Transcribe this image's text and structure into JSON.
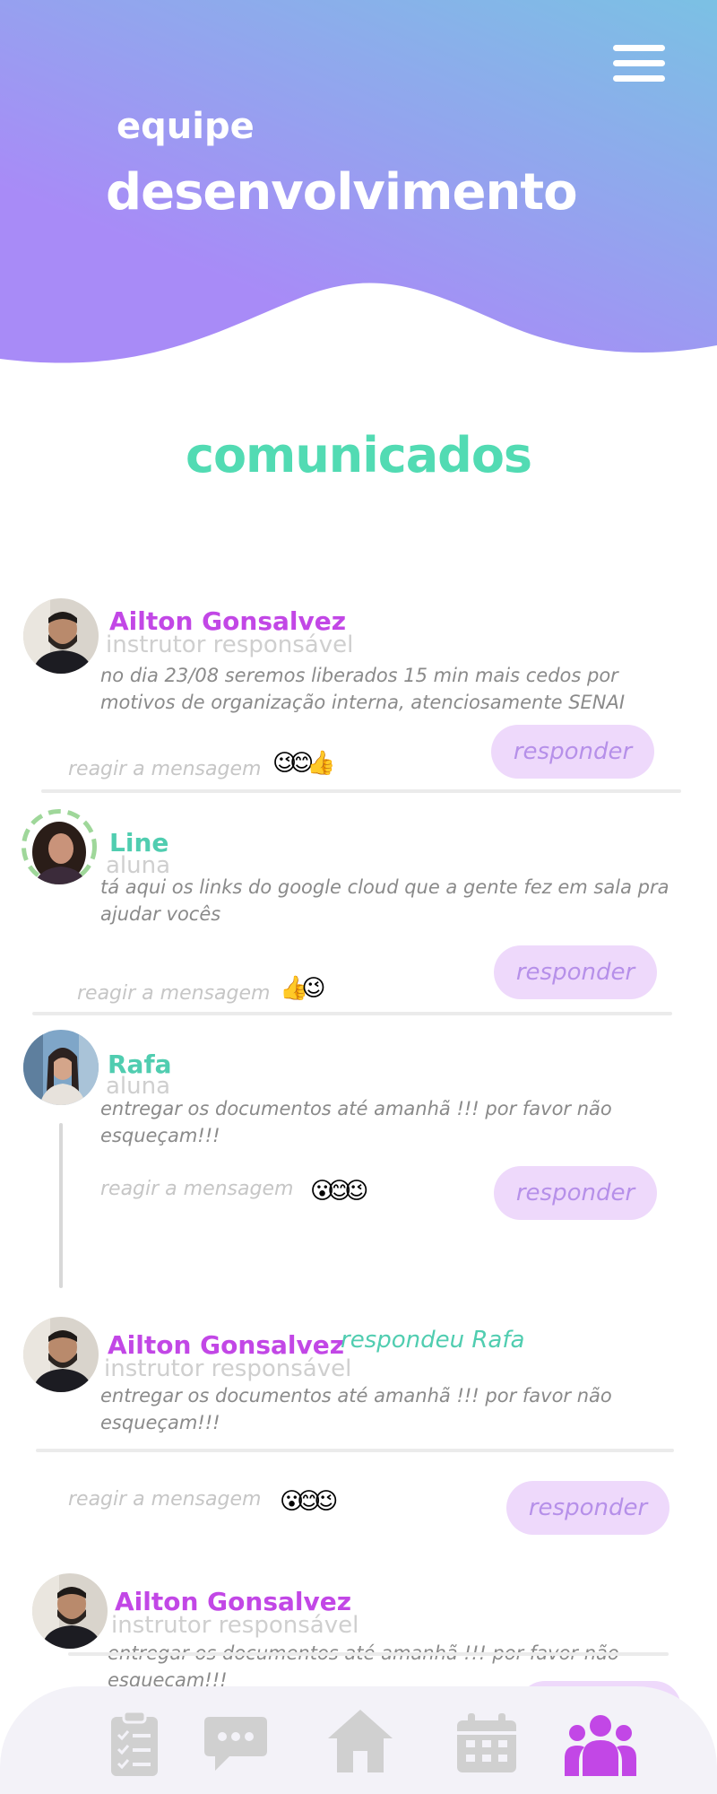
{
  "header": {
    "team_label": "equipe",
    "team_name": "desenvolvimento",
    "gradient": [
      "#7bc1e4",
      "#a88bf7"
    ],
    "menu_icon": "hamburger-menu-icon"
  },
  "section_title": "comunicados",
  "common": {
    "react_label": "reagir a mensagem",
    "reply_label": "responder"
  },
  "posts": [
    {
      "author": "Ailton Gonsalvez",
      "role": "instrutor responsável",
      "message": "no dia 23/08 seremos liberados  15 min mais cedos por motivos de organização interna, atenciosamente SENAI",
      "reactions": "😉😊👍"
    },
    {
      "author": "Line",
      "role": "aluna",
      "message": "tá aqui os links do google cloud que a gente fez em sala pra ajudar vocês",
      "reactions": "👍😉"
    },
    {
      "author": "Rafa",
      "role": "aluna",
      "message": "entregar os documentos até amanhã !!! por favor não esqueçam!!!",
      "reactions": "😮😊😉"
    },
    {
      "author": "Ailton Gonsalvez",
      "reply_note": "respondeu Rafa",
      "role": "instrutor responsável",
      "message": "entregar os documentos até amanhã !!! por favor não esqueçam!!!",
      "reactions": "😮😊😉"
    },
    {
      "author": "Ailton Gonsalvez",
      "role": "instrutor responsável",
      "message": "entregar os documentos até amanhã !!! por favor não esqueçam!!!"
    }
  ],
  "nav": {
    "items": [
      "checklist-icon",
      "chat-icon",
      "home-icon",
      "calendar-icon",
      "team-icon"
    ],
    "active": "team-icon",
    "active_color": "#c247e6",
    "inactive_color": "#d0d0d0"
  },
  "colors": {
    "accent_purple": "#c247e6",
    "accent_teal": "#52dbb3",
    "reply_bg": "#eed9fb",
    "reply_text": "#b690e9"
  }
}
